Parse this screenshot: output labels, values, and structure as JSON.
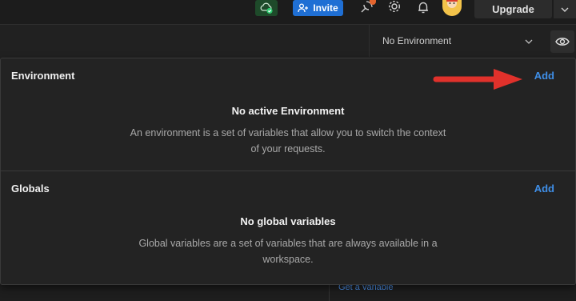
{
  "topbar": {
    "invite_label": "Invite",
    "upgrade_label": "Upgrade"
  },
  "environment_selector": {
    "selected": "No Environment"
  },
  "environment_section": {
    "title": "Environment",
    "add_label": "Add",
    "empty_title": "No active Environment",
    "empty_description": "An environment is a set of variables that allow you to switch the context of your requests."
  },
  "globals_section": {
    "title": "Globals",
    "add_label": "Add",
    "empty_title": "No global variables",
    "empty_description": "Global variables are a set of variables that are always available in a workspace."
  },
  "background": {
    "get_variable_link": "Get a variable"
  },
  "colors": {
    "accent": "#3f8fe8",
    "invite_bg": "#1f6fd4",
    "annotation_arrow": "#e0312b",
    "sync_ok": "#2ecc71"
  }
}
